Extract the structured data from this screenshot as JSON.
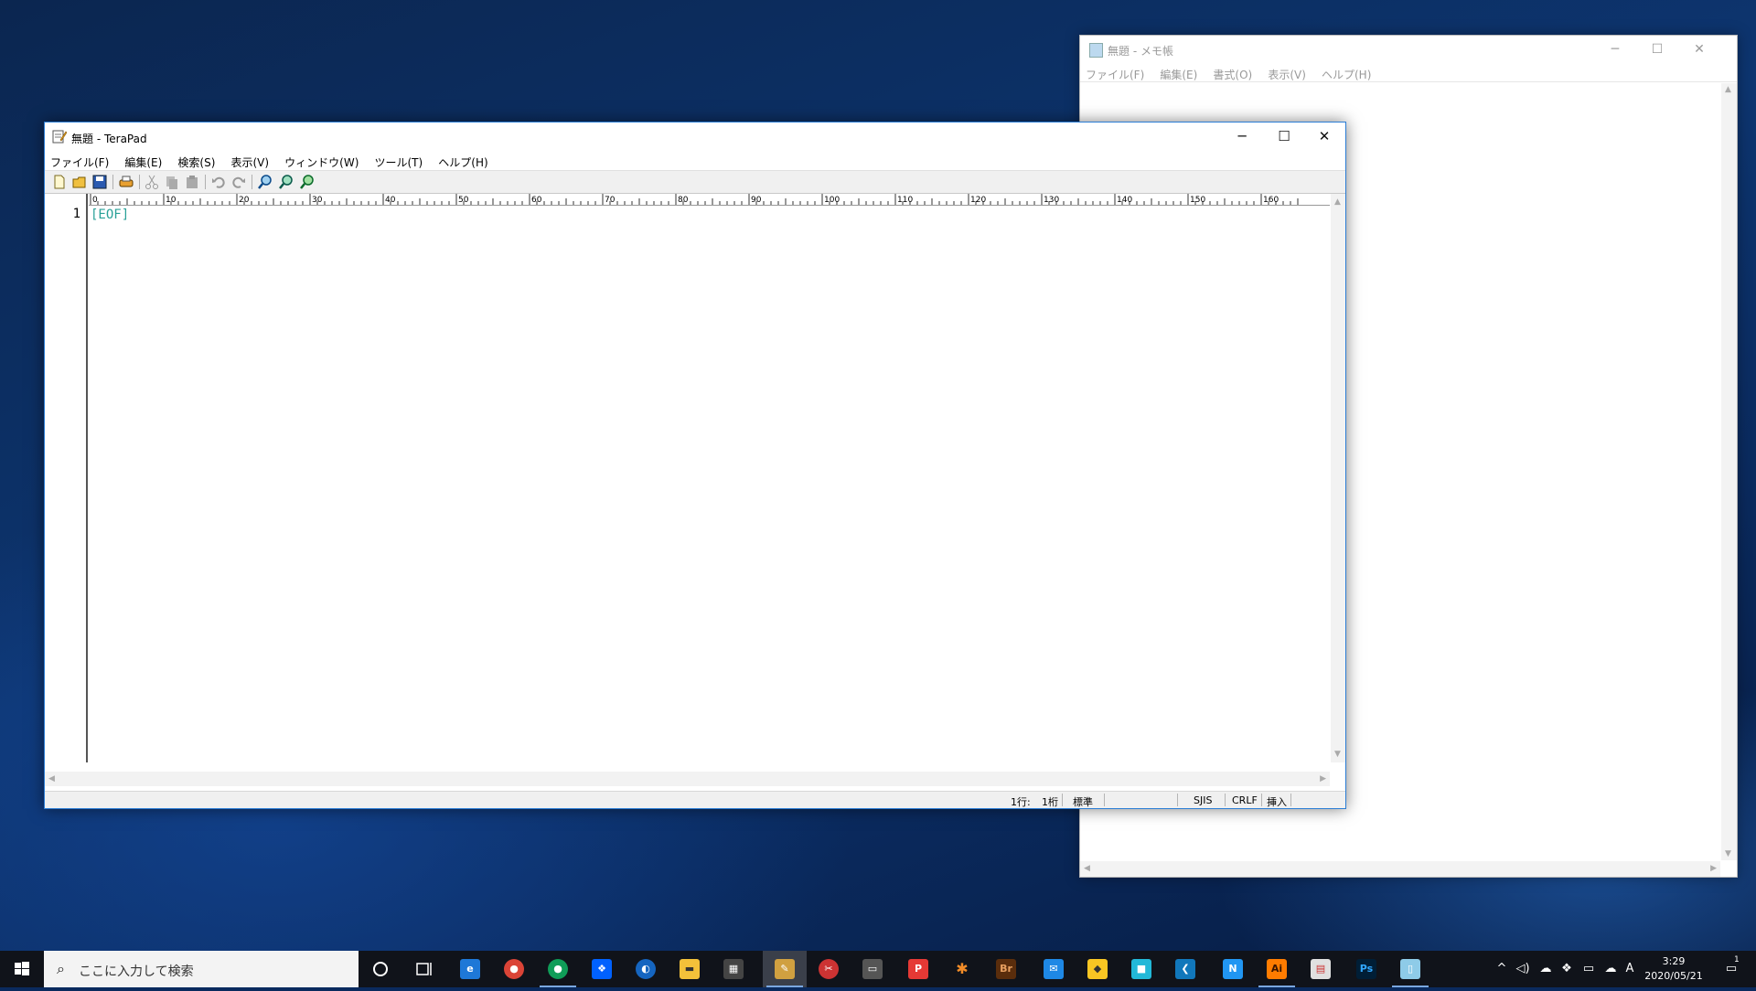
{
  "notepad": {
    "title": "無題 - メモ帳",
    "menu": [
      "ファイル(F)",
      "編集(E)",
      "書式(O)",
      "表示(V)",
      "ヘルプ(H)"
    ],
    "controls": {
      "minimize": "─",
      "maximize": "☐",
      "close": "✕"
    }
  },
  "terapad": {
    "title": "無題 - TeraPad",
    "menu": [
      "ファイル(F)",
      "編集(E)",
      "検索(S)",
      "表示(V)",
      "ウィンドウ(W)",
      "ツール(T)",
      "ヘルプ(H)"
    ],
    "controls": {
      "minimize": "─",
      "maximize": "☐",
      "close": "✕"
    },
    "ruler_labels": [
      "0",
      "10",
      "20",
      "30",
      "40",
      "50",
      "60",
      "70",
      "80",
      "90",
      "100",
      "110",
      "120",
      "130",
      "140",
      "150",
      "160"
    ],
    "line_numbers": [
      "1"
    ],
    "content": "[EOF]",
    "status": {
      "line": "1行:",
      "col": "1桁",
      "mode": "標準",
      "encoding": "SJIS",
      "linebreak": "CRLF",
      "insert": "挿入"
    },
    "toolbar_icons": [
      "new-file-icon",
      "open-folder-icon",
      "save-icon",
      "print-icon",
      "cut-icon",
      "copy-icon",
      "paste-icon",
      "undo-icon",
      "redo-icon",
      "search-icon",
      "search-next-icon",
      "search-replace-icon"
    ]
  },
  "taskbar": {
    "search_placeholder": "ここに入力して検索",
    "clock_time": "3:29",
    "clock_date": "2020/05/21",
    "ime": "A",
    "notification_count": "1"
  },
  "colors": {
    "accent": "#2b7dd5",
    "eof": "#2aa198",
    "taskbar": "#10131a"
  }
}
